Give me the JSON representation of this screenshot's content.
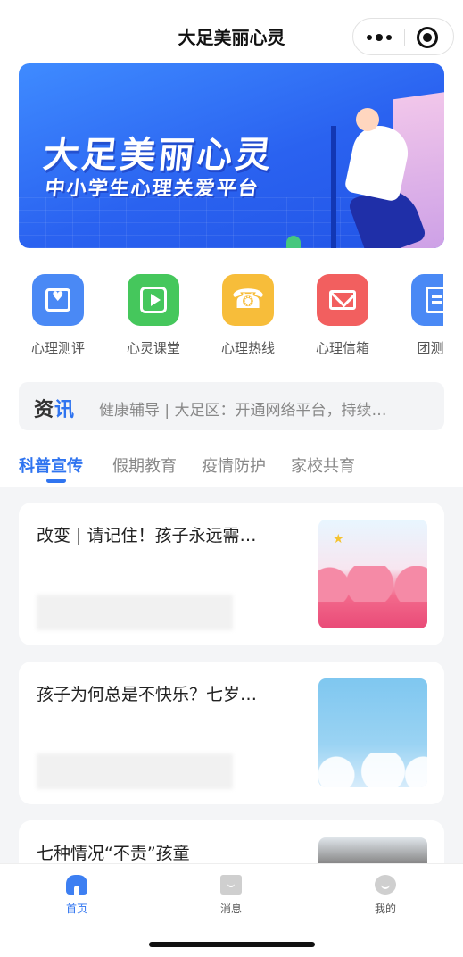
{
  "nav": {
    "title": "大足美丽心灵"
  },
  "banner": {
    "headline": "大足美丽心灵",
    "subline": "中小学生心理关爱平台"
  },
  "shortcuts": [
    {
      "label": "心理测评",
      "icon": "heart-board-icon",
      "color": "#4a89f5"
    },
    {
      "label": "心灵课堂",
      "icon": "play-icon",
      "color": "#45c75c"
    },
    {
      "label": "心理热线",
      "icon": "phone-icon",
      "color": "#f7bd3a"
    },
    {
      "label": "心理信箱",
      "icon": "mail-icon",
      "color": "#f25f5f"
    },
    {
      "label": "团测服",
      "icon": "document-icon",
      "color": "#4a89f5"
    }
  ],
  "news": {
    "tag_prefix": "资",
    "tag_accent": "讯",
    "headline": "健康辅导 | 大足区：开通网络平台，持续…"
  },
  "tabs": [
    "科普宣传",
    "假期教育",
    "疫情防护",
    "家校共育"
  ],
  "active_tab": "科普宣传",
  "articles": [
    {
      "title": "改变 | 请记住！孩子永远需…",
      "thumb": "pink-clouds"
    },
    {
      "title": "孩子为何总是不快乐？七岁…",
      "thumb": "sky-clouds"
    },
    {
      "title": "七种情况“不责”孩童",
      "thumb": "portrait-photo"
    }
  ],
  "tabbar": [
    {
      "label": "首页",
      "icon": "home-icon",
      "active": true
    },
    {
      "label": "消息",
      "icon": "message-icon",
      "active": false
    },
    {
      "label": "我的",
      "icon": "profile-icon",
      "active": false
    }
  ],
  "colors": {
    "accent": "#2f74f0",
    "text": "#222222",
    "muted": "#888888"
  }
}
